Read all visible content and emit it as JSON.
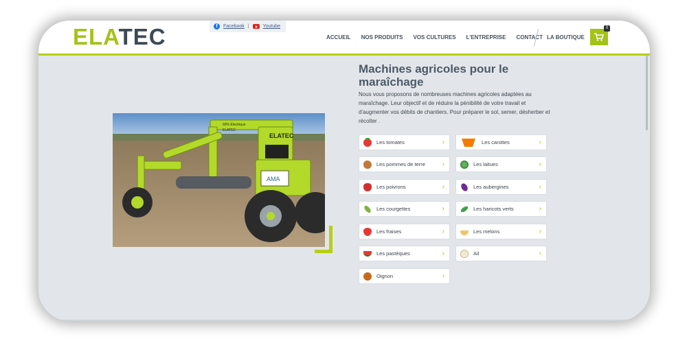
{
  "header": {
    "logo": {
      "part1": "EL",
      "part2": "A",
      "part3": "TEC"
    },
    "social": {
      "facebook": "Facebook",
      "separator": "|",
      "youtube": "Youtube"
    },
    "nav": [
      "ACCUEIL",
      "NOS PRODUITS",
      "VOS CULTURES",
      "L'ENTREPRISE",
      "CONTACT"
    ],
    "shop_label": "LA BOUTIQUE",
    "cart_count": "0"
  },
  "main": {
    "title": "Machines agricoles pour le maraîchage",
    "intro": "Nous vous proposons de nombreuses machines agricoles adaptées au maraîchage. Leur objectif et de réduire la pénibilité de votre travail et d'augmenter vos débits de chantiers. Pour préparer le sol, semer, désherber et récolter .",
    "photo_text": {
      "robot_brand": "ELATEC",
      "decal_small": "60% Électrique",
      "decal_brand": "ELATEC",
      "panel": "AMA"
    },
    "crops": [
      {
        "label": "Les tomates",
        "icon": "tomato-icon"
      },
      {
        "label": "Les carottes",
        "icon": "carrot-icon"
      },
      {
        "label": "Les pommes de terre",
        "icon": "potato-icon"
      },
      {
        "label": "Les laitues",
        "icon": "lettuce-icon"
      },
      {
        "label": "Les poivrons",
        "icon": "pepper-icon"
      },
      {
        "label": "Les aubergines",
        "icon": "eggplant-icon"
      },
      {
        "label": "Les courgettes",
        "icon": "zucchini-icon"
      },
      {
        "label": "Les haricots verts",
        "icon": "beans-icon"
      },
      {
        "label": "Les fraises",
        "icon": "strawberry-icon"
      },
      {
        "label": "Les melons",
        "icon": "melon-icon"
      },
      {
        "label": "Les pastèques",
        "icon": "watermelon-icon"
      },
      {
        "label": "Ail",
        "icon": "garlic-icon"
      },
      {
        "label": "Oignon",
        "icon": "onion-icon"
      }
    ],
    "chevron": "›"
  },
  "colors": {
    "brand_green": "#a3c318",
    "brand_dark": "#3d4a55",
    "background": "#e2e6ea"
  }
}
